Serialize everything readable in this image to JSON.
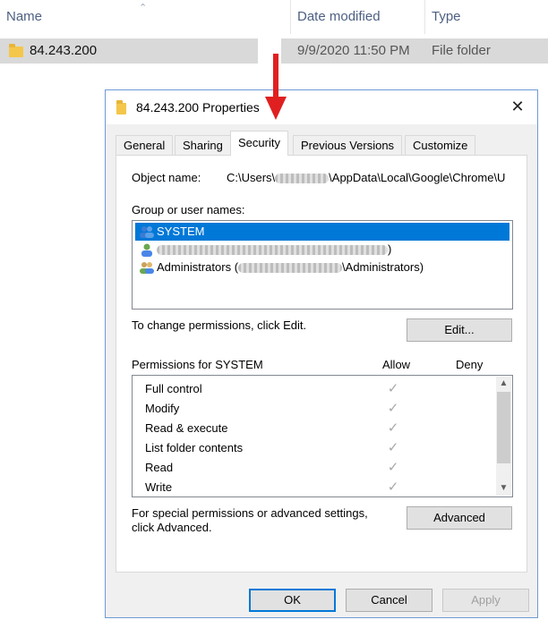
{
  "explorer": {
    "columns": {
      "name": "Name",
      "date_modified": "Date modified",
      "type": "Type"
    },
    "row": {
      "name": "84.243.200",
      "date": "9/9/2020 11:50 PM",
      "type": "File folder"
    }
  },
  "dialog": {
    "title": "84.243.200 Properties",
    "tabs": [
      "General",
      "Sharing",
      "Security",
      "Previous Versions",
      "Customize"
    ],
    "active_tab": "Security",
    "object_name_label": "Object name:",
    "object_name_prefix": "C:\\Users\\",
    "object_name_suffix": "\\AppData\\Local\\Google\\Chrome\\U",
    "group_label": "Group or user names:",
    "users": [
      {
        "name": "SYSTEM",
        "selected": true
      },
      {
        "name": ")",
        "selected": false
      },
      {
        "name_prefix": "Administrators (",
        "name_suffix": "\\Administrators)",
        "selected": false
      }
    ],
    "change_hint": "To change permissions, click Edit.",
    "edit_button": "Edit...",
    "permissions_label": "Permissions for SYSTEM",
    "allow_header": "Allow",
    "deny_header": "Deny",
    "permissions": [
      {
        "name": "Full control",
        "allow": true,
        "deny": false
      },
      {
        "name": "Modify",
        "allow": true,
        "deny": false
      },
      {
        "name": "Read & execute",
        "allow": true,
        "deny": false
      },
      {
        "name": "List folder contents",
        "allow": true,
        "deny": false
      },
      {
        "name": "Read",
        "allow": true,
        "deny": false
      },
      {
        "name": "Write",
        "allow": true,
        "deny": false
      }
    ],
    "special_hint_line1": "For special permissions or advanced settings,",
    "special_hint_line2": "click Advanced.",
    "advanced_button": "Advanced",
    "ok_button": "OK",
    "cancel_button": "Cancel",
    "apply_button": "Apply"
  },
  "colors": {
    "selection": "#0078d7",
    "annotation_arrow": "#e02020",
    "dialog_border": "#6f9ad6"
  },
  "icons": {
    "folder": "folder-icon",
    "close": "close-icon",
    "users": "users-icon",
    "user": "user-icon",
    "check": "check-icon"
  }
}
